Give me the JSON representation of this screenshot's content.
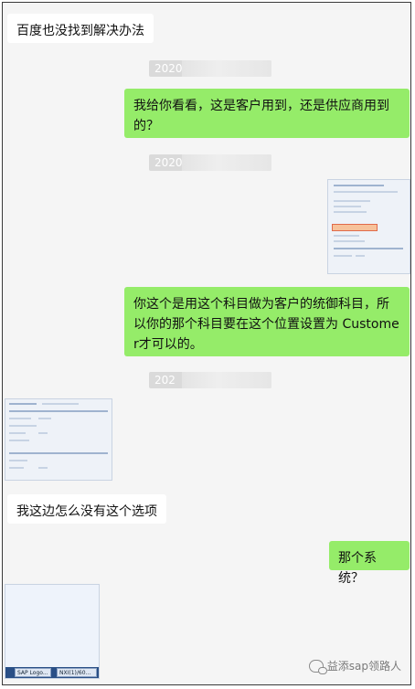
{
  "messages": [
    {
      "side": "left",
      "text": "百度也没找到解决办法"
    },
    {
      "side": "right",
      "text": "我给你看看，这是客户用到，还是供应商用到的？"
    },
    {
      "side": "right",
      "text": "你这个是用这个科目做为客户的统御科目，所以你的那个科目要在这个位置设置为 Customer才可以的。"
    },
    {
      "side": "left",
      "text": "我这边怎么没有这个选项"
    },
    {
      "side": "right",
      "text": "那个系统？"
    }
  ],
  "timestamps": [
    "2020",
    "2020",
    "202"
  ],
  "taskbar": {
    "btn1": "SAP Logo...",
    "btn2": "NXI(1)/60..."
  },
  "watermark": {
    "text": "益添sap领路人",
    "icon": "wechat-icon"
  },
  "colors": {
    "right_bubble": "#95ec69",
    "left_bubble": "#ffffff",
    "background": "#f5f5f5"
  }
}
